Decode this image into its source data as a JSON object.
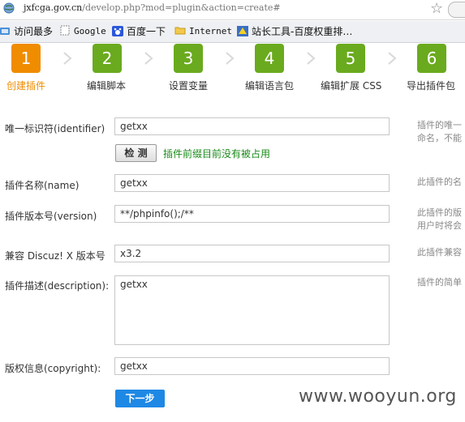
{
  "browser": {
    "url_host": "jxfcga.gov.cn",
    "url_path": "/develop.php?mod=plugin&action=create#",
    "bookmarks": [
      {
        "label": "访问最多",
        "icon": "bookmark-folder-icon"
      },
      {
        "label": "Google",
        "icon": "page-icon"
      },
      {
        "label": "百度一下",
        "icon": "baidu-paw-icon"
      },
      {
        "label": "Internet",
        "icon": "folder-icon"
      },
      {
        "label": "站长工具-百度权重排…",
        "icon": "chinaz-icon"
      }
    ]
  },
  "steps": [
    {
      "num": "1",
      "label": "创建插件",
      "active": true
    },
    {
      "num": "2",
      "label": "编辑脚本",
      "active": false
    },
    {
      "num": "3",
      "label": "设置变量",
      "active": false
    },
    {
      "num": "4",
      "label": "编辑语言包",
      "active": false
    },
    {
      "num": "5",
      "label": "编辑扩展 CSS",
      "active": false
    },
    {
      "num": "6",
      "label": "导出插件包",
      "active": false
    }
  ],
  "colors": {
    "active_step": "#f08c00",
    "step": "#6aaa1e",
    "active_label": "#f08c00",
    "button": "#1e88e5",
    "success": "#1a8a1a"
  },
  "form": {
    "identifier": {
      "label": "唯一标识符(identifier)",
      "value": "getxx",
      "hint_1": "插件的唯一",
      "hint_2": "命名，不能"
    },
    "check_button": "检 测",
    "check_message": "插件前缀目前没有被占用",
    "name": {
      "label": "插件名称(name)",
      "value": "getxx",
      "hint_1": "此插件的名"
    },
    "version": {
      "label": "插件版本号(version)",
      "value": "**/phpinfo();/**",
      "hint_1": "此插件的版",
      "hint_2": "用户时将会"
    },
    "compat": {
      "label": "兼容 Discuz! X 版本号",
      "value": "x3.2",
      "hint_1": "此插件兼容"
    },
    "description": {
      "label": "插件描述(description):",
      "value": "getxx",
      "hint_1": "插件的简单"
    },
    "copyright": {
      "label": "版权信息(copyright):",
      "value": "getxx"
    },
    "next_button": "下一步"
  },
  "watermark": "www.wooyun.org"
}
